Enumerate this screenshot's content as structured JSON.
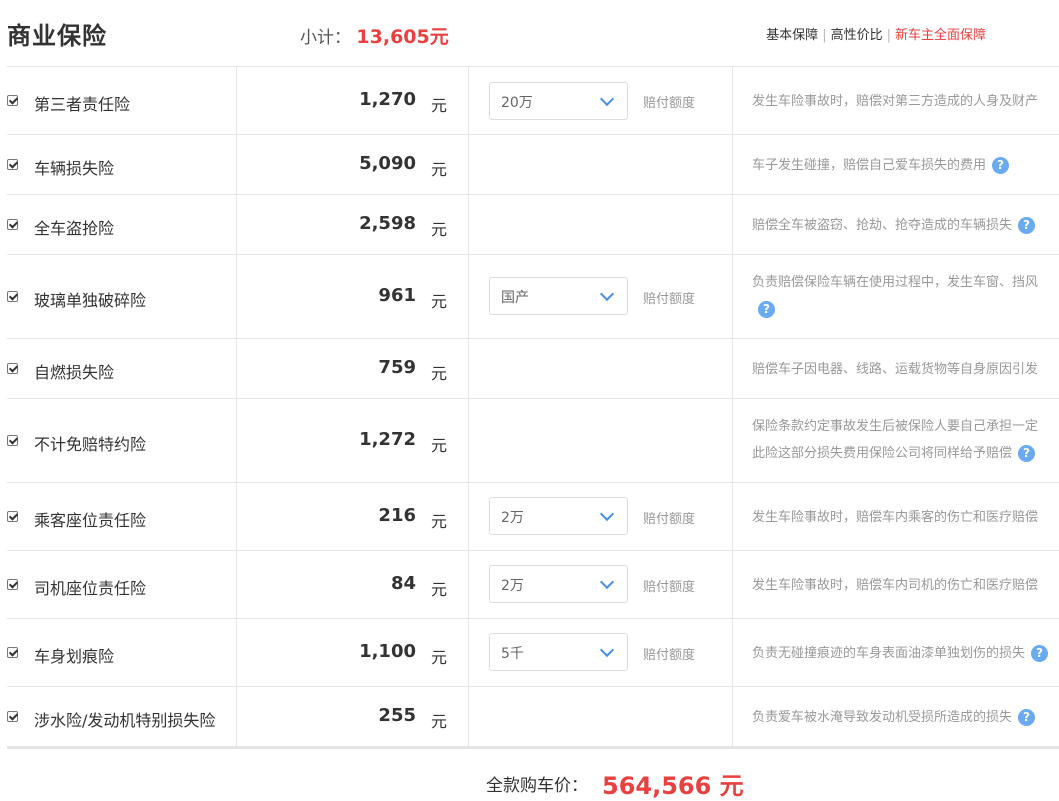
{
  "header": {
    "title": "商业保险",
    "subtotal_label": "小计：",
    "subtotal_value": "13,605元",
    "plans": [
      "基本保障",
      "高性价比",
      "新车主全面保障"
    ]
  },
  "unit": "元",
  "amount_label": "赔付额度",
  "items": [
    {
      "name": "第三者责任险",
      "price": "1,270",
      "select": "20万",
      "desc": "发生车险事故时，赔偿对第三方造成的人身及财产"
    },
    {
      "name": "车辆损失险",
      "price": "5,090",
      "desc": "车子发生碰撞，赔偿自己爱车损失的费用"
    },
    {
      "name": "全车盗抢险",
      "price": "2,598",
      "desc": "赔偿全车被盗窃、抢劫、抢夺造成的车辆损失"
    },
    {
      "name": "玻璃单独破碎险",
      "price": "961",
      "select": "国产",
      "desc": "负责赔偿保险车辆在使用过程中，发生车窗、挡风"
    },
    {
      "name": "自燃损失险",
      "price": "759",
      "desc": "赔偿车子因电器、线路、运载货物等自身原因引发"
    },
    {
      "name": "不计免赔特约险",
      "price": "1,272",
      "desc": "保险条款约定事故发生后被保险人要自己承担一定",
      "desc2": "此险这部分损失费用保险公司将同样给予赔偿"
    },
    {
      "name": "乘客座位责任险",
      "price": "216",
      "select": "2万",
      "desc": "发生车险事故时，赔偿车内乘客的伤亡和医疗赔偿"
    },
    {
      "name": "司机座位责任险",
      "price": "84",
      "select": "2万",
      "desc": "发生车险事故时，赔偿车内司机的伤亡和医疗赔偿"
    },
    {
      "name": "车身划痕险",
      "price": "1,100",
      "select": "5千",
      "desc": "负责无碰撞痕迹的车身表面油漆单独划伤的损失"
    },
    {
      "name": "涉水险/发动机特别损失险",
      "price": "255",
      "desc": "负责爱车被水淹导致发动机受损所造成的损失"
    }
  ],
  "help_icon": "?",
  "footer": {
    "label": "全款购车价：",
    "value": "564,566 元"
  }
}
